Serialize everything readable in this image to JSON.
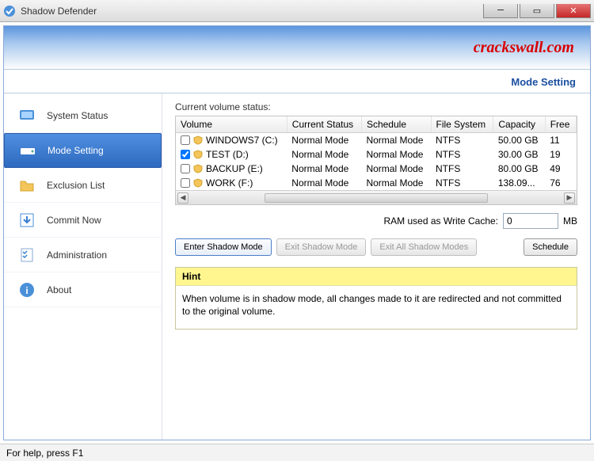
{
  "window": {
    "title": "Shadow Defender"
  },
  "watermark": "crackswall.com",
  "section_title": "Mode Setting",
  "nav": {
    "items": [
      {
        "label": "System Status"
      },
      {
        "label": "Mode Setting"
      },
      {
        "label": "Exclusion List"
      },
      {
        "label": "Commit Now"
      },
      {
        "label": "Administration"
      },
      {
        "label": "About"
      }
    ]
  },
  "content": {
    "subheading": "Current volume status:",
    "columns": [
      "Volume",
      "Current Status",
      "Schedule",
      "File System",
      "Capacity",
      "Free"
    ],
    "rows": [
      {
        "checked": false,
        "volume": "WINDOWS7 (C:)",
        "status": "Normal Mode",
        "schedule": "Normal Mode",
        "fs": "NTFS",
        "capacity": "50.00 GB",
        "free": "11"
      },
      {
        "checked": true,
        "volume": "TEST (D:)",
        "status": "Normal Mode",
        "schedule": "Normal Mode",
        "fs": "NTFS",
        "capacity": "30.00 GB",
        "free": "19"
      },
      {
        "checked": false,
        "volume": "BACKUP (E:)",
        "status": "Normal Mode",
        "schedule": "Normal Mode",
        "fs": "NTFS",
        "capacity": "80.00 GB",
        "free": "49"
      },
      {
        "checked": false,
        "volume": "WORK (F:)",
        "status": "Normal Mode",
        "schedule": "Normal Mode",
        "fs": "NTFS",
        "capacity": "138.09...",
        "free": "76"
      }
    ],
    "ram_label": "RAM used as Write Cache:",
    "ram_value": "0",
    "ram_unit": "MB",
    "buttons": {
      "enter": "Enter Shadow Mode",
      "exit": "Exit Shadow Mode",
      "exit_all": "Exit All Shadow Modes",
      "schedule": "Schedule"
    },
    "hint_title": "Hint",
    "hint_body": "When volume is in shadow mode, all changes made to it are redirected and not committed to the original volume."
  },
  "statusbar": "For help, press F1"
}
